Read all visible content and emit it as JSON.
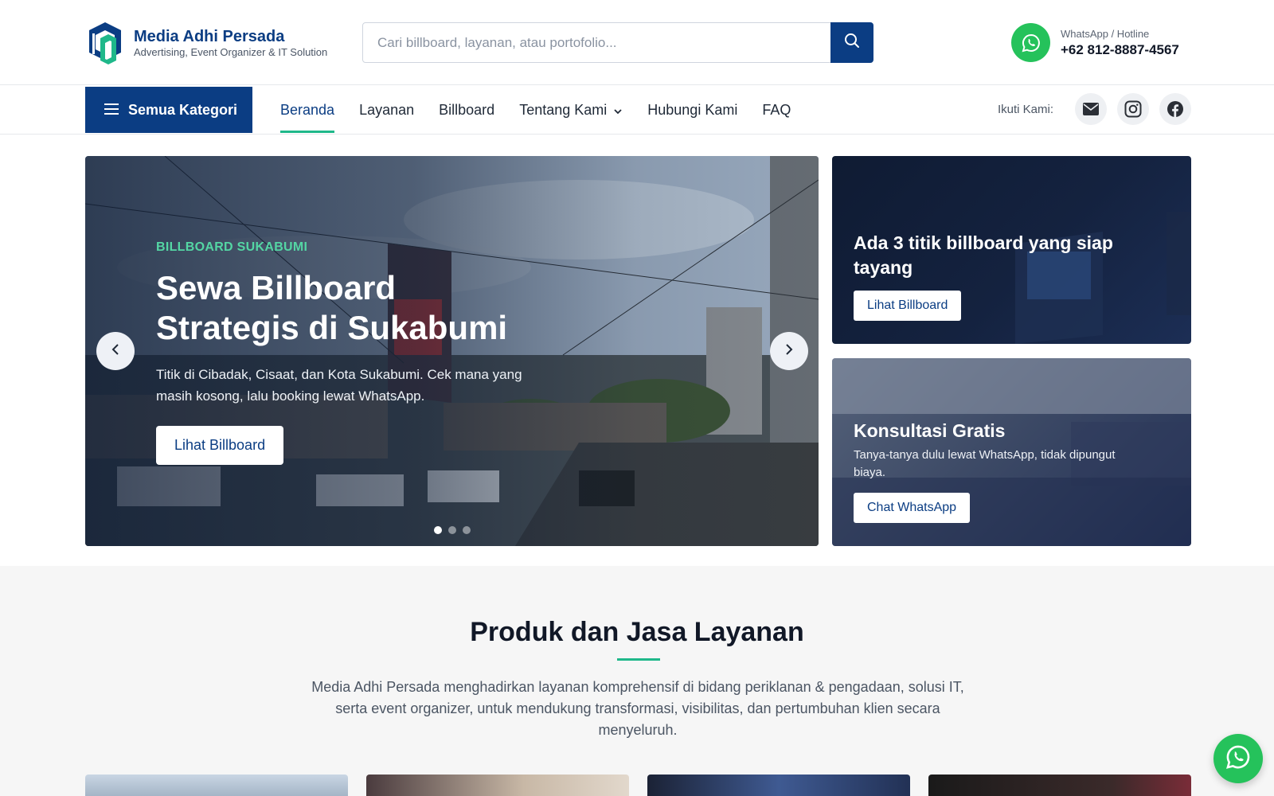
{
  "brand": {
    "name": "Media Adhi Persada",
    "tagline": "Advertising, Event Organizer & IT Solution",
    "primary_color": "#0b3d83",
    "accent_color": "#1fb88a",
    "whatsapp_color": "#25c25b"
  },
  "search": {
    "placeholder": "Cari billboard, layanan, atau portofolio...",
    "button_icon": "search-icon"
  },
  "hotline": {
    "label": "WhatsApp / Hotline",
    "number": "+62 812-8887-4567",
    "icon": "whatsapp-icon"
  },
  "nav": {
    "all_categories": "Semua Kategori",
    "links": [
      {
        "label": "Beranda",
        "active": true
      },
      {
        "label": "Layanan"
      },
      {
        "label": "Billboard"
      },
      {
        "label": "Tentang Kami",
        "dropdown": true
      },
      {
        "label": "Hubungi Kami"
      },
      {
        "label": "FAQ"
      }
    ],
    "follow_label": "Ikuti Kami:",
    "socials": [
      "mail-icon",
      "instagram-icon",
      "facebook-icon"
    ]
  },
  "hero": {
    "kicker": "BILLBOARD SUKABUMI",
    "title": "Sewa Billboard Strategis di Sukabumi",
    "description": "Titik di Cibadak, Cisaat, dan Kota Sukabumi. Cek mana yang masih kosong, lalu booking lewat WhatsApp.",
    "button": "Lihat Billboard",
    "slides": 3,
    "active_slide": 1
  },
  "promos": [
    {
      "title": "Ada 3 titik billboard yang siap tayang",
      "button": "Lihat Billboard"
    },
    {
      "title": "Konsultasi Gratis",
      "text": "Tanya-tanya dulu lewat WhatsApp, tidak dipungut biaya.",
      "button": "Chat WhatsApp"
    }
  ],
  "section": {
    "title": "Produk dan Jasa Layanan",
    "description": "Media Adhi Persada menghadirkan layanan komprehensif di bidang periklanan & pengadaan, solusi IT, serta event organizer, untuk mendukung transformasi, visibilitas, dan pertumbuhan klien secara menyeluruh."
  }
}
